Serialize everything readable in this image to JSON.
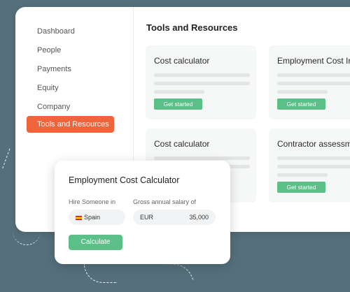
{
  "sidebar": {
    "items": [
      {
        "label": "Dashboard"
      },
      {
        "label": "People"
      },
      {
        "label": "Payments"
      },
      {
        "label": "Equity"
      },
      {
        "label": "Company"
      },
      {
        "label": "Tools and Resources",
        "active": true
      }
    ]
  },
  "main": {
    "title": "Tools and Resources",
    "cards": [
      {
        "title": "Cost calculator",
        "button": "Get started"
      },
      {
        "title": "Employment Cost In",
        "button": "Get started"
      },
      {
        "title": "Cost calculator",
        "button": ""
      },
      {
        "title": "Contractor assessme",
        "button": "Get started"
      }
    ]
  },
  "calculator": {
    "title": "Employment Cost Calculator",
    "hire_label": "Hire Someone in",
    "salary_label": "Gross annual salary of",
    "country": "Spain",
    "currency": "EUR",
    "amount": "35,000",
    "button": "Calculate"
  },
  "colors": {
    "background": "#55707c",
    "accent_orange": "#f0643c",
    "button_green": "#5cbf88"
  }
}
